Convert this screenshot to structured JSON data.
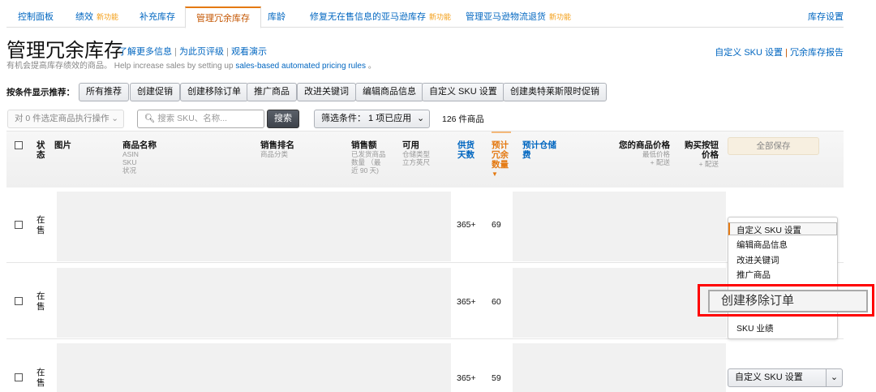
{
  "tabs": [
    {
      "label": "控制面板"
    },
    {
      "label": "绩效",
      "badge": "新功能"
    },
    {
      "label": "补充库存"
    },
    {
      "label": "管理冗余库存"
    },
    {
      "label": "库龄"
    },
    {
      "label": "修复无在售信息的亚马逊库存",
      "badge": "新功能"
    },
    {
      "label": "管理亚马逊物流退货",
      "badge": "新功能"
    }
  ],
  "inventory_settings": "库存设置",
  "page_title": "管理冗余库存",
  "title_links": [
    "了解更多信息",
    "为此页评级",
    "观看演示"
  ],
  "subtitle": "有机会提高库存绩效的商品。 Help increase sales by setting up ",
  "subtitle_link": "sales-based automated pricing rules",
  "subtitle_end": " 。",
  "right_links": [
    "自定义 SKU 设置",
    "冗余库存报告"
  ],
  "recommend_label": "按条件显示推荐：",
  "recommend_buttons": [
    "所有推荐",
    "创建促销",
    "创建移除订单",
    "推广商品",
    "改进关键词",
    "编辑商品信息",
    "自定义 SKU 设置",
    "创建奥特莱斯限时促销"
  ],
  "bulk_action": "对 0 件选定商品执行操作",
  "search_placeholder": "搜索 SKU、名称...",
  "search_button": "搜索",
  "filter": "筛选条件： 1 项已应用",
  "count": "126 件商品",
  "headers": {
    "status": "状态",
    "image": "图片",
    "name": "商品名称",
    "name_sub": [
      "ASIN",
      "SKU",
      "状况"
    ],
    "rank": "销售排名",
    "rank_sub": "商品分类",
    "sales": "销售额",
    "sales_sub": "已发货商品数量 （最近 90 天)",
    "avail": "可用",
    "avail_sub": "仓储类型 立方英尺",
    "supply": "供货天数",
    "excess": "预计冗余数量",
    "fee": "预计仓储费",
    "price": "您的商品价格",
    "price_sub1": "最低价格",
    "price_sub2": "+ 配送",
    "buybox": "购买按钮价格",
    "buybox_sub": "+ 配送",
    "save_all": "全部保存"
  },
  "rows": [
    {
      "status": "在售",
      "supply": "365+",
      "excess": "69"
    },
    {
      "status": "在售",
      "supply": "365+",
      "excess": "60"
    },
    {
      "status": "在售",
      "supply": "365+",
      "excess": "59"
    }
  ],
  "menu": [
    "自定义 SKU 设置",
    "编辑商品信息",
    "改进关键词",
    "推广商品",
    "创建移除订单",
    "SKU 业绩"
  ],
  "row3_action": "自定义 SKU 设置"
}
